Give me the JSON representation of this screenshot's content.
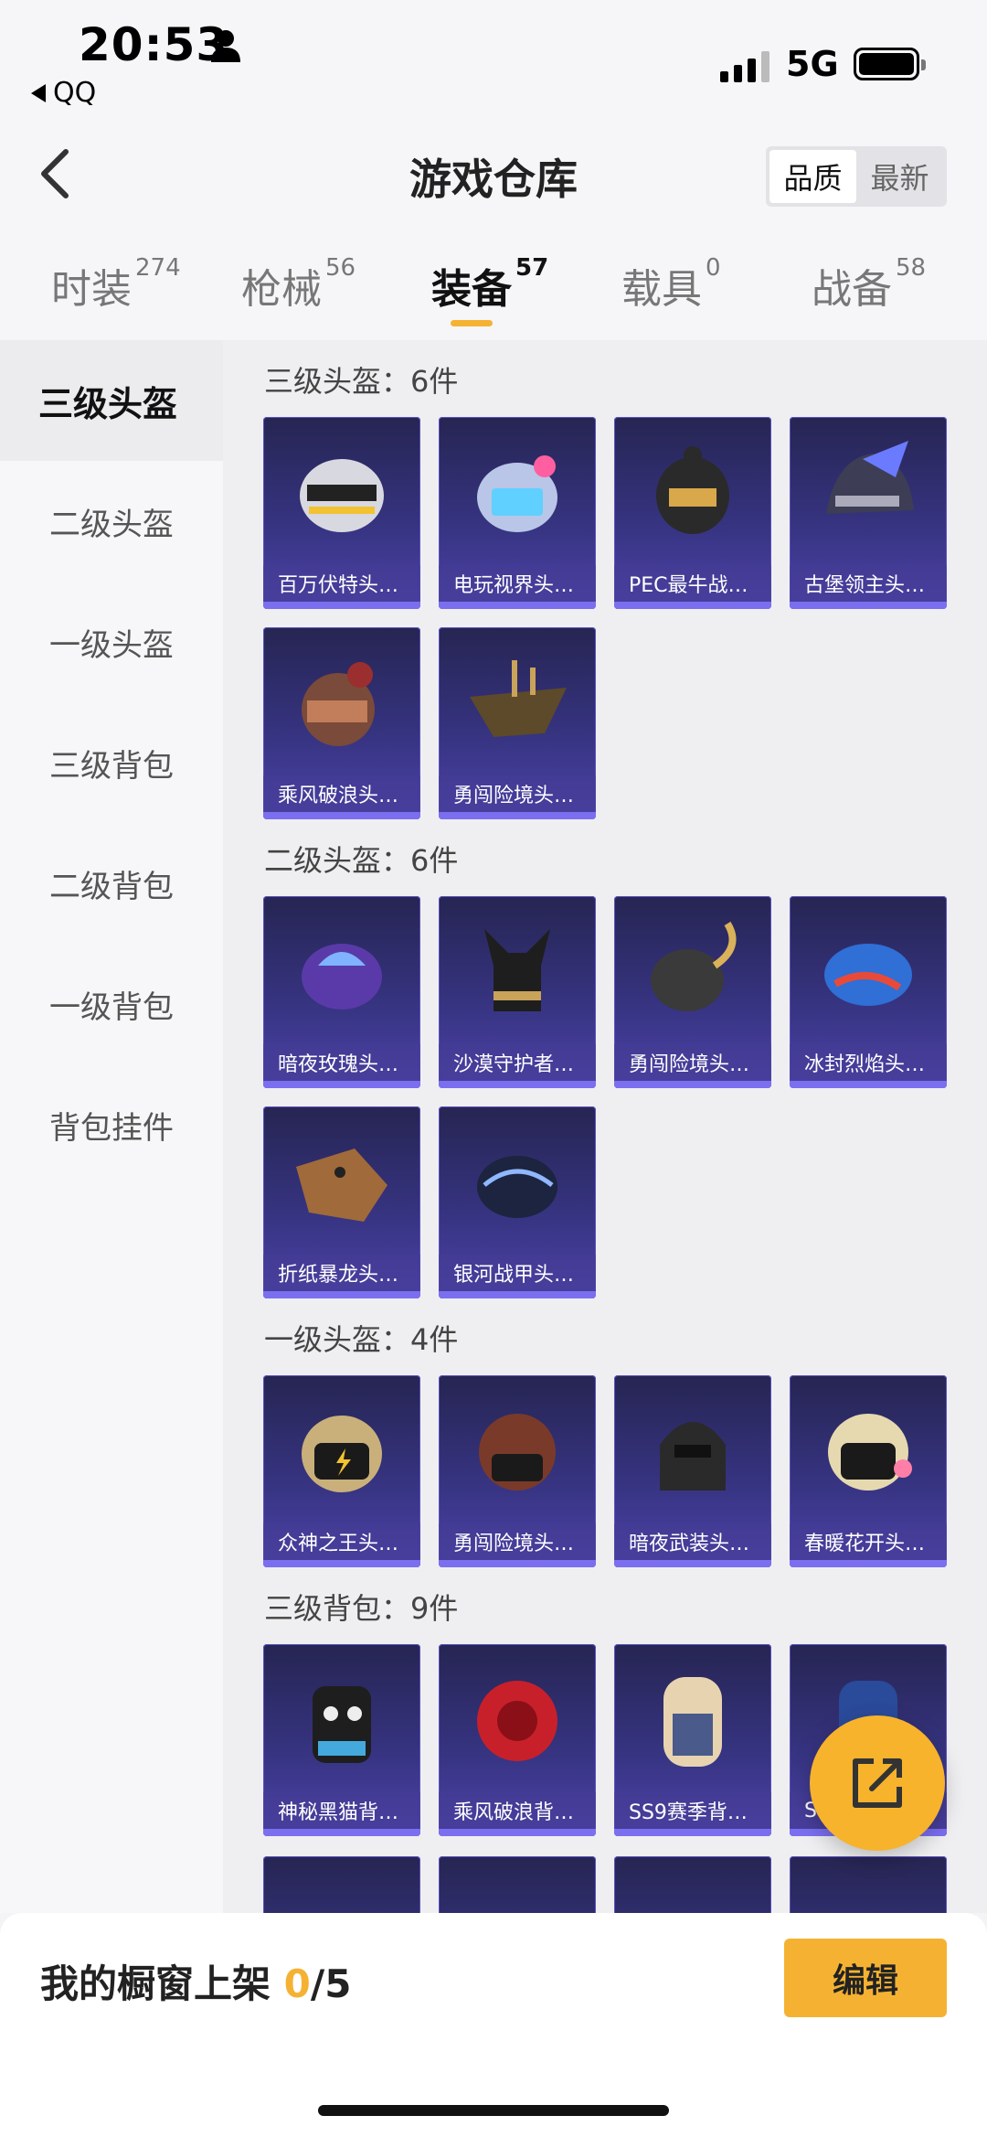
{
  "status": {
    "time": "20:53",
    "back_app": "QQ",
    "network": "5G"
  },
  "header": {
    "title": "游戏仓库",
    "sort_options": [
      "品质",
      "最新"
    ],
    "sort_active": "品质"
  },
  "tabs": [
    {
      "label": "时装",
      "count": "274"
    },
    {
      "label": "枪械",
      "count": "56"
    },
    {
      "label": "装备",
      "count": "57"
    },
    {
      "label": "载具",
      "count": "0"
    },
    {
      "label": "战备",
      "count": "58"
    }
  ],
  "sidebar": {
    "items": [
      "三级头盔",
      "二级头盔",
      "一级头盔",
      "三级背包",
      "二级背包",
      "一级背包",
      "背包挂件"
    ],
    "active": "三级头盔"
  },
  "sections": [
    {
      "title": "三级头盔：6件",
      "items": [
        "百万伏特头…",
        "电玩视界头…",
        "PEC最牛战…",
        "古堡领主头…",
        "乘风破浪头…",
        "勇闯险境头…"
      ]
    },
    {
      "title": "二级头盔：6件",
      "items": [
        "暗夜玫瑰头…",
        "沙漠守护者…",
        "勇闯险境头…",
        "冰封烈焰头…",
        "折纸暴龙头…",
        "银河战甲头…"
      ]
    },
    {
      "title": "一级头盔：4件",
      "items": [
        "众神之王头…",
        "勇闯险境头…",
        "暗夜武装头…",
        "春暖花开头…"
      ]
    },
    {
      "title": "三级背包：9件",
      "items": [
        "神秘黑猫背…",
        "乘风破浪背…",
        "SS9赛季背…",
        "S"
      ]
    }
  ],
  "bottom": {
    "shelf_label": "我的橱窗上架",
    "shelf_current": "0",
    "shelf_total": "/5",
    "edit_label": "编辑"
  },
  "colors": {
    "accent": "#f5b232",
    "card_bg": "#363380"
  }
}
